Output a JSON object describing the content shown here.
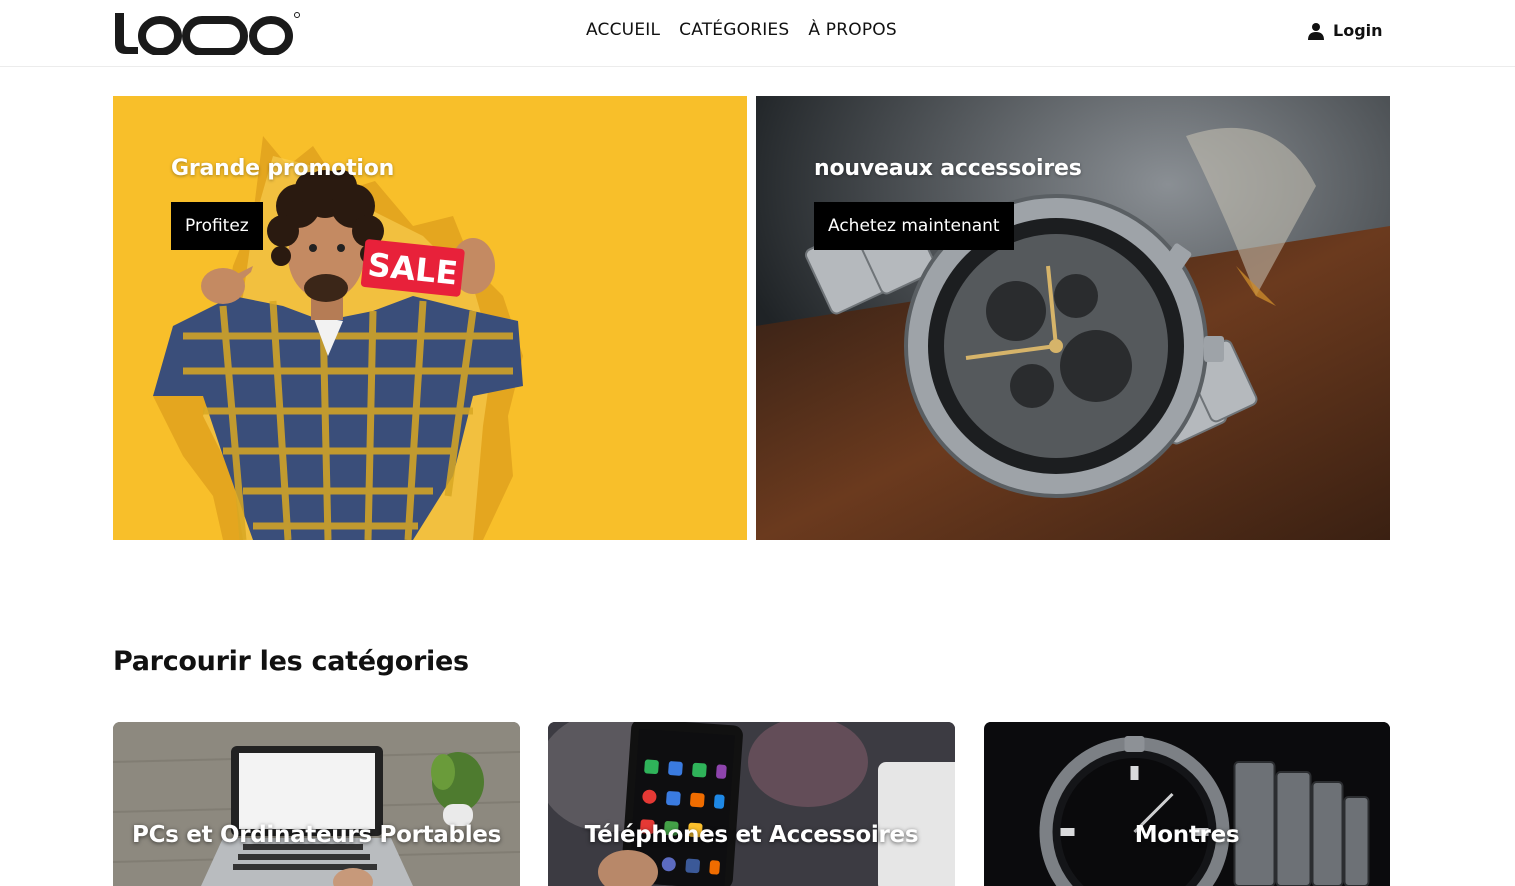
{
  "header": {
    "logo_text": "LOQO",
    "nav": [
      {
        "label": "ACCUEIL"
      },
      {
        "label": "CATÉGORIES"
      },
      {
        "label": "À PROPOS"
      }
    ],
    "login_label": "Login"
  },
  "hero": [
    {
      "title": "Grande promotion",
      "button": "Profitez",
      "badge": "SALE"
    },
    {
      "title": "nouveaux accessoires",
      "button": "Achetez maintenant"
    }
  ],
  "categories": {
    "title": "Parcourir les catégories",
    "items": [
      {
        "label": "PCs et Ordinateurs Portables"
      },
      {
        "label": "Téléphones et Accessoires"
      },
      {
        "label": "Montres"
      }
    ]
  },
  "colors": {
    "promo_yellow": "#f8bf2a",
    "button_black": "#000000",
    "sale_red": "#e8213a"
  }
}
